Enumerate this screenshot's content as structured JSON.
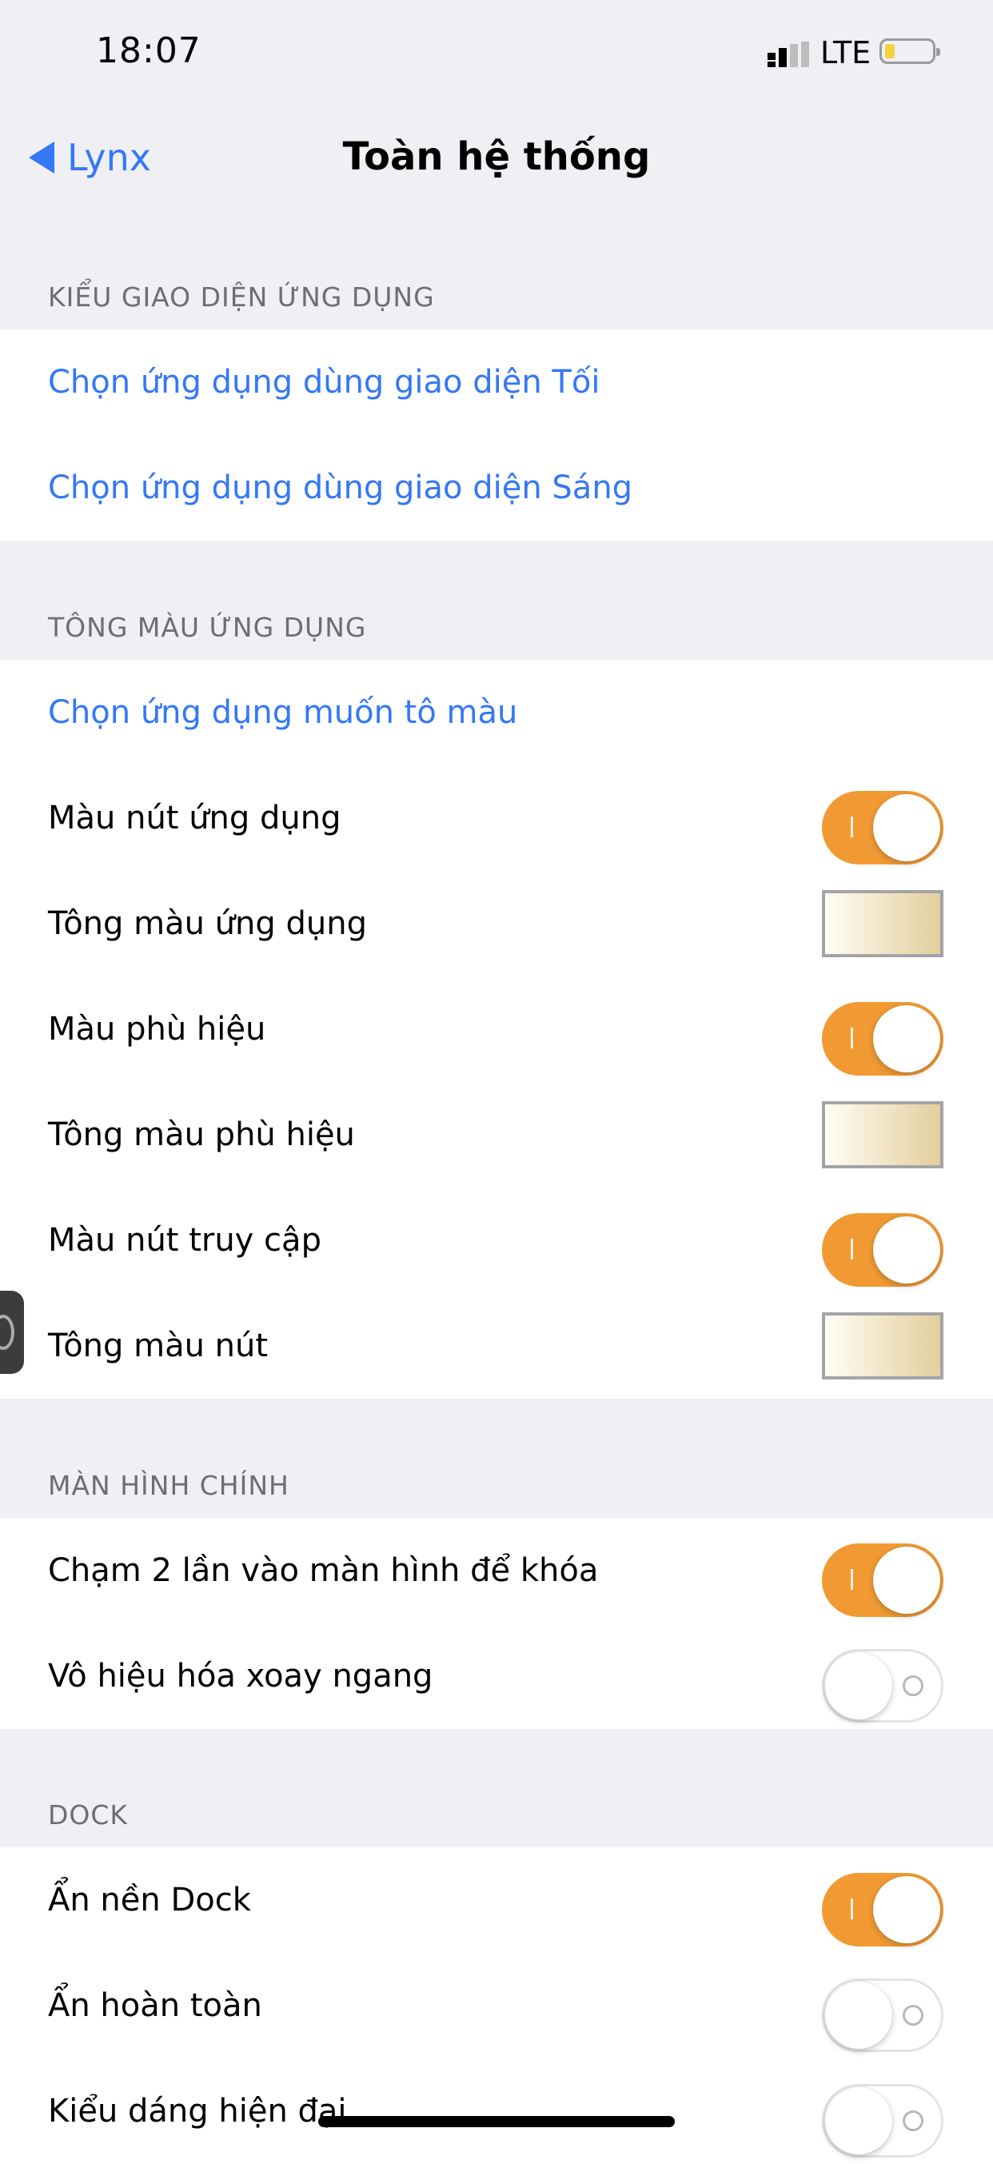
{
  "status": {
    "time": "18:07",
    "network": "LTE"
  },
  "nav": {
    "back_label": "Lynx",
    "title": "Toàn hệ thống"
  },
  "sections": [
    {
      "header": "KIỂU GIAO DIỆN ỨNG DỤNG",
      "rows": [
        {
          "label": "Chọn ứng dụng dùng giao diện Tối",
          "type": "link"
        },
        {
          "label": "Chọn ứng dụng dùng giao diện Sáng",
          "type": "link"
        }
      ]
    },
    {
      "header": "TÔNG MÀU ỨNG DỤNG",
      "rows": [
        {
          "label": "Chọn ứng dụng muốn tô màu",
          "type": "link"
        },
        {
          "label": "Màu nút ứng dụng",
          "type": "toggle",
          "on": true
        },
        {
          "label": "Tông màu ứng dụng",
          "type": "swatch"
        },
        {
          "label": "Màu phù hiệu",
          "type": "toggle",
          "on": true
        },
        {
          "label": "Tông màu phù hiệu",
          "type": "swatch"
        },
        {
          "label": "Màu nút truy cập",
          "type": "toggle",
          "on": true
        },
        {
          "label": "Tông màu nút",
          "type": "swatch"
        }
      ]
    },
    {
      "header": "MÀN HÌNH CHÍNH",
      "rows": [
        {
          "label": "Chạm 2 lần vào màn hình để khóa",
          "type": "toggle",
          "on": true
        },
        {
          "label": "Vô hiệu hóa xoay ngang",
          "type": "toggle",
          "on": false
        }
      ]
    },
    {
      "header": "DOCK",
      "rows": [
        {
          "label": "Ẩn nền Dock",
          "type": "toggle",
          "on": true
        },
        {
          "label": "Ẩn hoàn toàn",
          "type": "toggle",
          "on": false
        },
        {
          "label": "Kiểu dáng hiện đại",
          "type": "toggle",
          "on": false
        }
      ]
    }
  ],
  "colors": {
    "accent": "#f19a33",
    "link": "#3478f6",
    "background": "#efeff4",
    "swatch_gradient": [
      "#fffdf5",
      "#e2cf9e"
    ]
  },
  "icons": [
    "back-chevron-icon",
    "cellular-signal-icon",
    "battery-icon",
    "assistive-touch-icon"
  ]
}
